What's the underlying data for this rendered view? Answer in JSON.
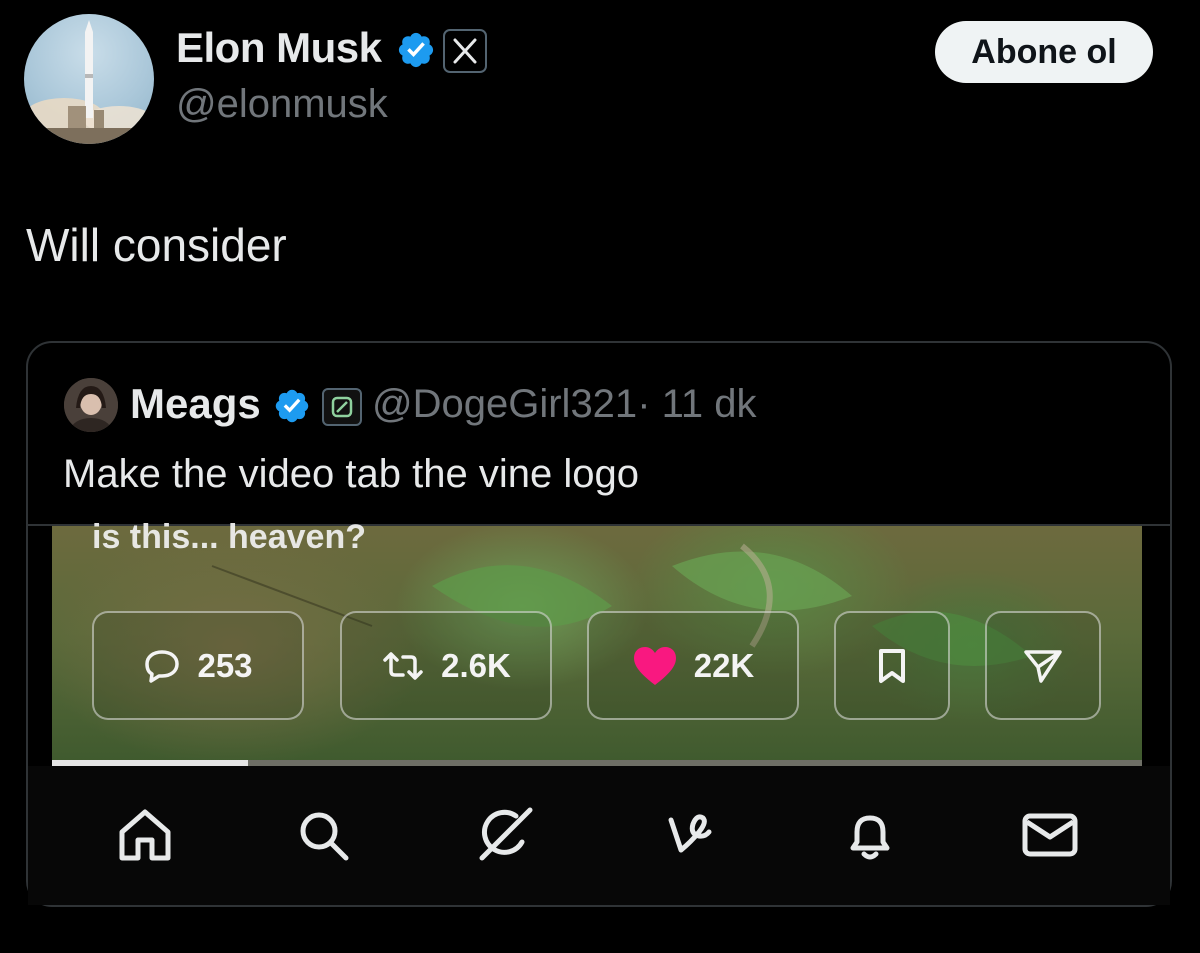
{
  "tweet": {
    "author_name": "Elon Musk",
    "author_handle": "@elonmusk",
    "follow_label": "Abone ol",
    "text": "Will consider",
    "badge_icon": "x-logo-icon",
    "verified_icon": "verified-badge-icon"
  },
  "quote": {
    "author_name": "Meags",
    "author_handle": "@DogeGirl321",
    "time": "· 11 dk",
    "text": "Make the video tab the vine logo",
    "verified_icon": "verified-badge-icon",
    "affiliate_icon": "affiliate-badge-icon"
  },
  "media": {
    "caption": "is this... heaven?",
    "actions": {
      "reply_count": "253",
      "repost_count": "2.6K",
      "like_count": "22K"
    },
    "progress": 0.18,
    "nav_icons": [
      "home-icon",
      "search-icon",
      "grok-icon",
      "vine-icon",
      "bell-icon",
      "mail-icon"
    ]
  },
  "colors": {
    "background": "#000000",
    "text": "#e7e9ea",
    "muted": "#71767b",
    "verified": "#1d9bf0",
    "like": "#f91880",
    "border": "#2f3336"
  }
}
